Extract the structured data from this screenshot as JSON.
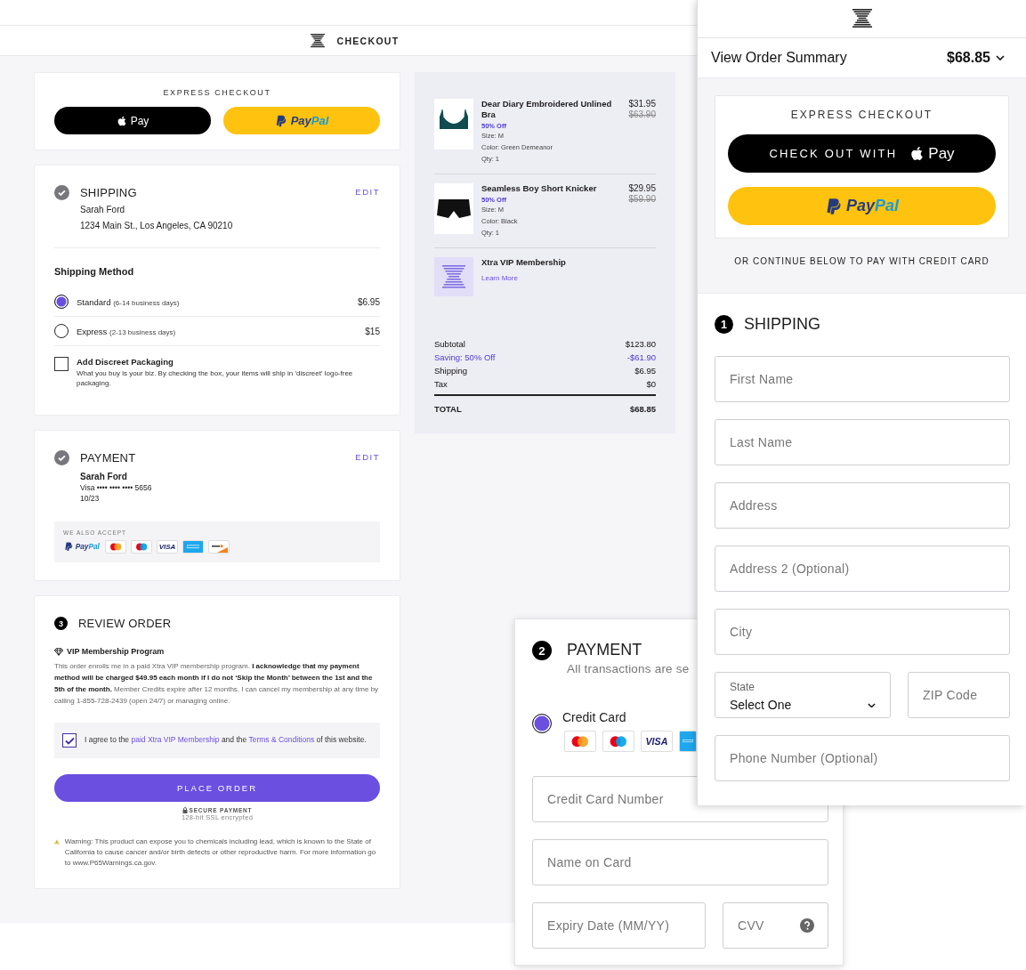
{
  "checkout_page": {
    "header": {
      "title": "CHECKOUT"
    },
    "express_checkout": {
      "title": "EXPRESS CHECKOUT",
      "buttons": [
        {
          "kind": "apple_pay",
          "label": "Pay"
        },
        {
          "kind": "paypal",
          "label_parts": [
            "Pay",
            "Pal"
          ]
        }
      ]
    },
    "shipping": {
      "title": "SHIPPING",
      "edit": "EDIT",
      "name": "Sarah Ford",
      "address": "1234 Main St., Los Angeles, CA 90210",
      "method_title": "Shipping Method",
      "methods": [
        {
          "label": "Standard",
          "detail": "(6-14 business days)",
          "price": "$6.95",
          "selected": true
        },
        {
          "label": "Express",
          "detail": "(2-13 business days)",
          "price": "$15",
          "selected": false
        }
      ],
      "discreet": {
        "label": "Add Discreet Packaging",
        "description": "What you buy is your biz. By checking the box, your items will ship in 'discreet' logo-free packaging.",
        "checked": false
      }
    },
    "payment": {
      "title": "PAYMENT",
      "edit": "EDIT",
      "name": "Sarah Ford",
      "card": "Visa •••• •••• •••• 5656",
      "expiry": "10/23",
      "accept_title": "WE ALSO ACCEPT",
      "accept": [
        {
          "kind": "paypal",
          "label_parts": [
            "Pay",
            "Pal"
          ]
        },
        {
          "kind": "mastercard"
        },
        {
          "kind": "maestro"
        },
        {
          "kind": "visa",
          "text": "VISA"
        },
        {
          "kind": "amex"
        },
        {
          "kind": "discover"
        }
      ]
    },
    "review": {
      "step": "3",
      "title": "REVIEW ORDER",
      "vip_title": "VIP Membership Program",
      "terms": "This order enrolls me in a paid Xtra VIP membership program. **I acknowledge that my payment method will be charged $49.95 each month if I do not ‘Skip the Month’ between the 1st and the 5th of the month.** Member Credits expire after 12 months. I can cancel my membership at any time by calling 1-855-728-2439 (open 24/7) or managing online.",
      "agreement": {
        "checked": true,
        "parts": [
          {
            "kind": "text",
            "text": "I agree to the "
          },
          {
            "kind": "link",
            "text": "paid Xtra VIP Membership"
          },
          {
            "kind": "text",
            "text": " and the "
          },
          {
            "kind": "link",
            "text": "Terms & Conditions"
          },
          {
            "kind": "text",
            "text": " of this website."
          }
        ]
      },
      "place_order": "PLACE ORDER",
      "secure_title": "SECURE PAYMENT",
      "secure_subtitle": "128-bit SSL encrypted",
      "warning": "Warning: This product can expose you to chemicals including lead, which is known to the State of California to cause cancer and/or birth defects or other reproductive harm. For more information go to www.P65Warnings.ca.gov."
    },
    "order_summary": {
      "items": [
        {
          "kind": "bra",
          "name": "Dear Diary Embroidered Unlined Bra",
          "discount": "50% Off",
          "details": [
            "Size: M",
            "Color: Green Demeanor",
            "Qty: 1"
          ],
          "price": "$31.95",
          "original_price": "$63.90"
        },
        {
          "kind": "shorts",
          "name": "Seamless Boy Short Knicker",
          "discount": "50% Off",
          "details": [
            "Size: M",
            "Color: Black",
            "Qty: 1"
          ],
          "price": "$29.95",
          "original_price": "$59.90"
        },
        {
          "kind": "membership",
          "name": "Xtra VIP Membership",
          "link": "Learn More"
        }
      ],
      "totals": [
        {
          "kind": "plain",
          "label": "Subtotal",
          "value": "$123.80"
        },
        {
          "kind": "saving",
          "label": "Saving: 50% Off",
          "value": "-$61.90"
        },
        {
          "kind": "plain",
          "label": "Shipping",
          "value": "$6.95"
        },
        {
          "kind": "plain",
          "label": "Tax",
          "value": "$0"
        }
      ],
      "total": {
        "label": "TOTAL",
        "value": "$68.85"
      }
    }
  },
  "mobile_checkout": {
    "summary": {
      "label": "View Order Summary",
      "total": "$68.85"
    },
    "express_checkout": {
      "title": "EXPRESS CHECKOUT",
      "buttons": [
        {
          "kind": "apple_pay",
          "prefix": "CHECK OUT WITH",
          "label": "Pay"
        },
        {
          "kind": "paypal",
          "label_parts": [
            "Pay",
            "Pal"
          ]
        }
      ]
    },
    "note": "OR CONTINUE BELOW TO PAY WITH CREDIT CARD",
    "shipping": {
      "step": "1",
      "title": "SHIPPING",
      "fields": [
        {
          "kind": "text",
          "placeholder": "First Name"
        },
        {
          "kind": "text",
          "placeholder": "Last Name"
        },
        {
          "kind": "text",
          "placeholder": "Address"
        },
        {
          "kind": "text",
          "placeholder": "Address 2 (Optional)"
        },
        {
          "kind": "text",
          "placeholder": "City"
        },
        {
          "kind": "select",
          "label": "State",
          "value": "Select One"
        },
        {
          "kind": "short",
          "placeholder": "ZIP Code"
        },
        {
          "kind": "text",
          "placeholder": "Phone Number (Optional)"
        }
      ]
    }
  },
  "payment_form": {
    "step": "2",
    "title": "PAYMENT",
    "subtitle": "All transactions are se",
    "method": {
      "label": "Credit Card",
      "selected": true
    },
    "cards": [
      {
        "kind": "mastercard"
      },
      {
        "kind": "maestro"
      },
      {
        "kind": "visa",
        "text": "VISA"
      },
      {
        "kind": "amex"
      }
    ],
    "fields": [
      {
        "kind": "text",
        "placeholder": "Credit Card Number"
      },
      {
        "kind": "text",
        "placeholder": "Name on Card"
      },
      {
        "kind": "expiry",
        "placeholder": "Expiry Date (MM/YY)"
      },
      {
        "kind": "cvv",
        "placeholder": "CVV"
      }
    ]
  }
}
